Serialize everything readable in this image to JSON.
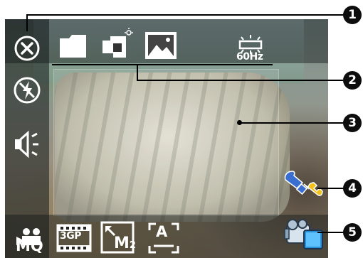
{
  "icons": {
    "close": "close-icon",
    "folder": "folder-icon",
    "self_timer": "self-timer-icon",
    "photo_mode": "photo-mode-icon",
    "flicker": "flicker-icon",
    "flash": "flash-off-icon",
    "sound": "speaker-icon",
    "movie_quality": "movie-quality-icon",
    "format_3gp": "3gp-format-icon",
    "zoom": "zoom-icon",
    "auto_mode": "auto-mode-icon",
    "settings": "settings-wrench-icon",
    "camcorder": "camcorder-icon"
  },
  "labels": {
    "flicker_freq": "60Hz",
    "movie_quality": "MQ",
    "format": "3GP",
    "zoom_mark": "M",
    "zoom_sub": "2",
    "auto": "A"
  },
  "callouts": [
    "1",
    "2",
    "3",
    "4",
    "5"
  ],
  "colors": {
    "icon": "#ffffff",
    "callout_bg": "#0d0d0d",
    "wrench_blue": "#3a6fd1",
    "wrench_yellow": "#f2c21b"
  }
}
